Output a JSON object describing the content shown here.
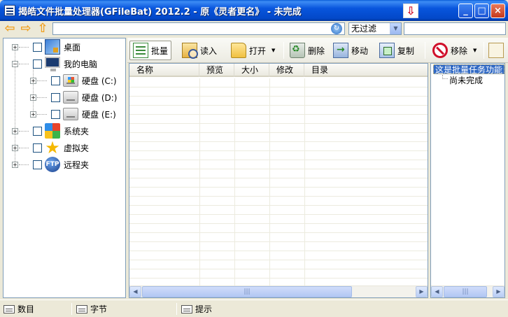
{
  "window": {
    "title": "揭皓文件批量处理器(GFileBat) 2012.2 - 原《灵者更名》 - 未完成"
  },
  "address_bar": {
    "value": "",
    "filter_selected": "无过滤",
    "filter_value": ""
  },
  "tree": {
    "items": [
      {
        "label": "桌面",
        "icon": "desktop-icon"
      },
      {
        "label": "我的电脑",
        "icon": "computer-icon"
      },
      {
        "label": "硬盘 (C:)",
        "icon": "drive-icon"
      },
      {
        "label": "硬盘 (D:)",
        "icon": "drive-icon"
      },
      {
        "label": "硬盘 (E:)",
        "icon": "drive-icon"
      },
      {
        "label": "系统夹",
        "icon": "system-folder-icon"
      },
      {
        "label": "虚拟夹",
        "icon": "star-icon"
      },
      {
        "label": "远程夹",
        "icon": "ftp-icon"
      }
    ]
  },
  "toolbar": {
    "batch_label": "批量",
    "read_label": "读入",
    "open_label": "打开",
    "delete_label": "删除",
    "move_label": "移动",
    "copy_label": "复制",
    "remove_label": "移除"
  },
  "file_list": {
    "columns": [
      "名称",
      "预览",
      "大小",
      "修改",
      "目录"
    ]
  },
  "tasks": {
    "title": "这是批量任务功能",
    "sub": "尚未完成"
  },
  "statusbar": {
    "count_label": "数目",
    "bytes_label": "字节",
    "tip_label": "提示"
  }
}
